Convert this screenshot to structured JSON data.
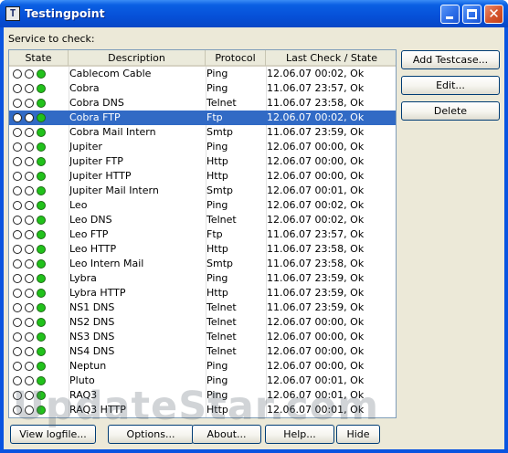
{
  "window": {
    "title": "Testingpoint",
    "icon_glyph": "T"
  },
  "label": "Service to check:",
  "columns": [
    "State",
    "Description",
    "Protocol",
    "Last Check / State"
  ],
  "selected_index": 3,
  "rows": [
    {
      "desc": "Cablecom Cable",
      "protocol": "Ping",
      "last": "12.06.07 00:02, Ok"
    },
    {
      "desc": "Cobra",
      "protocol": "Ping",
      "last": "11.06.07 23:57, Ok"
    },
    {
      "desc": "Cobra DNS",
      "protocol": "Telnet",
      "last": "11.06.07 23:58, Ok"
    },
    {
      "desc": "Cobra FTP",
      "protocol": "Ftp",
      "last": "12.06.07 00:02, Ok"
    },
    {
      "desc": "Cobra Mail Intern",
      "protocol": "Smtp",
      "last": "11.06.07 23:59, Ok"
    },
    {
      "desc": "Jupiter",
      "protocol": "Ping",
      "last": "12.06.07 00:00, Ok"
    },
    {
      "desc": "Jupiter FTP",
      "protocol": "Http",
      "last": "12.06.07 00:00, Ok"
    },
    {
      "desc": "Jupiter HTTP",
      "protocol": "Http",
      "last": "12.06.07 00:00, Ok"
    },
    {
      "desc": "Jupiter Mail Intern",
      "protocol": "Smtp",
      "last": "12.06.07 00:01, Ok"
    },
    {
      "desc": "Leo",
      "protocol": "Ping",
      "last": "12.06.07 00:02, Ok"
    },
    {
      "desc": "Leo DNS",
      "protocol": "Telnet",
      "last": "12.06.07 00:02, Ok"
    },
    {
      "desc": "Leo FTP",
      "protocol": "Ftp",
      "last": "11.06.07 23:57, Ok"
    },
    {
      "desc": "Leo HTTP",
      "protocol": "Http",
      "last": "11.06.07 23:58, Ok"
    },
    {
      "desc": "Leo Intern Mail",
      "protocol": "Smtp",
      "last": "11.06.07 23:58, Ok"
    },
    {
      "desc": "Lybra",
      "protocol": "Ping",
      "last": "11.06.07 23:59, Ok"
    },
    {
      "desc": "Lybra HTTP",
      "protocol": "Http",
      "last": "11.06.07 23:59, Ok"
    },
    {
      "desc": "NS1 DNS",
      "protocol": "Telnet",
      "last": "11.06.07 23:59, Ok"
    },
    {
      "desc": "NS2 DNS",
      "protocol": "Telnet",
      "last": "12.06.07 00:00, Ok"
    },
    {
      "desc": "NS3 DNS",
      "protocol": "Telnet",
      "last": "12.06.07 00:00, Ok"
    },
    {
      "desc": "NS4 DNS",
      "protocol": "Telnet",
      "last": "12.06.07 00:00, Ok"
    },
    {
      "desc": "Neptun",
      "protocol": "Ping",
      "last": "12.06.07 00:00, Ok"
    },
    {
      "desc": "Pluto",
      "protocol": "Ping",
      "last": "12.06.07 00:01, Ok"
    },
    {
      "desc": "RAQ3",
      "protocol": "Ping",
      "last": "12.06.07 00:01, Ok"
    },
    {
      "desc": "RAQ3 HTTP",
      "protocol": "Http",
      "last": "12.06.07 00:01, Ok"
    }
  ],
  "side_buttons": {
    "add": "Add Testcase...",
    "edit": "Edit...",
    "delete": "Delete"
  },
  "bottom_buttons": {
    "logfile": "View logfile...",
    "options": "Options...",
    "about": "About...",
    "help": "Help...",
    "hide": "Hide"
  },
  "watermark": "UpdateStar.com",
  "colors": {
    "titlebar": "#0a54e0",
    "selection": "#316ac5",
    "status_green": "#21c21b",
    "face": "#ece9d8"
  }
}
